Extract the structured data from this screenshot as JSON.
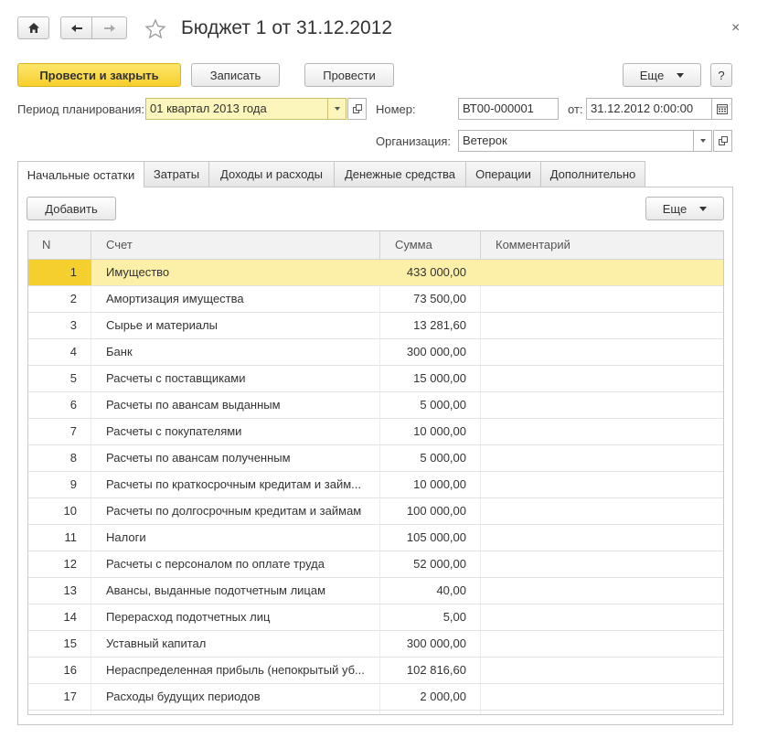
{
  "window": {
    "title": "Бюджет 1 от 31.12.2012",
    "close_glyph": "×"
  },
  "toolbar": {
    "post_close_label": "Провести и закрыть",
    "save_label": "Записать",
    "post_label": "Провести",
    "more_label": "Еще",
    "help_label": "?"
  },
  "header": {
    "period_label": "Период планирования:",
    "period_value": "01 квартал 2013 года",
    "number_label": "Номер:",
    "number_value": "ВТ00-000001",
    "date_label": "от:",
    "date_value": "31.12.2012  0:00:00",
    "org_label": "Организация:",
    "org_value": "Ветерок"
  },
  "tabs": [
    {
      "label": "Начальные остатки",
      "active": true
    },
    {
      "label": "Затраты"
    },
    {
      "label": "Доходы и расходы"
    },
    {
      "label": "Денежные средства"
    },
    {
      "label": "Операции"
    },
    {
      "label": "Дополнительно"
    }
  ],
  "tab_toolbar": {
    "add_label": "Добавить",
    "more_label": "Еще"
  },
  "table": {
    "columns": [
      "N",
      "Счет",
      "Сумма",
      "Комментарий"
    ],
    "rows": [
      {
        "n": "1",
        "account": "Имущество",
        "sum": "433 000,00",
        "comment": ""
      },
      {
        "n": "2",
        "account": "Амортизация имущества",
        "sum": "73 500,00",
        "comment": ""
      },
      {
        "n": "3",
        "account": "Сырье и материалы",
        "sum": "13 281,60",
        "comment": ""
      },
      {
        "n": "4",
        "account": "Банк",
        "sum": "300 000,00",
        "comment": ""
      },
      {
        "n": "5",
        "account": "Расчеты с поставщиками",
        "sum": "15 000,00",
        "comment": ""
      },
      {
        "n": "6",
        "account": "Расчеты по авансам выданным",
        "sum": "5 000,00",
        "comment": ""
      },
      {
        "n": "7",
        "account": "Расчеты с покупателями",
        "sum": "10 000,00",
        "comment": ""
      },
      {
        "n": "8",
        "account": "Расчеты по авансам полученным",
        "sum": "5 000,00",
        "comment": ""
      },
      {
        "n": "9",
        "account": "Расчеты по краткосрочным кредитам и займ...",
        "sum": "10 000,00",
        "comment": ""
      },
      {
        "n": "10",
        "account": "Расчеты по долгосрочным кредитам и займам",
        "sum": "100 000,00",
        "comment": ""
      },
      {
        "n": "11",
        "account": "Налоги",
        "sum": "105 000,00",
        "comment": ""
      },
      {
        "n": "12",
        "account": "Расчеты с персоналом по оплате труда",
        "sum": "52 000,00",
        "comment": ""
      },
      {
        "n": "13",
        "account": "Авансы, выданные подотчетным лицам",
        "sum": "40,00",
        "comment": ""
      },
      {
        "n": "14",
        "account": "Перерасход подотчетных лиц",
        "sum": "5,00",
        "comment": ""
      },
      {
        "n": "15",
        "account": "Уставный капитал",
        "sum": "300 000,00",
        "comment": ""
      },
      {
        "n": "16",
        "account": "Нераспределенная прибыль (непокрытый уб...",
        "sum": "102 816,60",
        "comment": ""
      },
      {
        "n": "17",
        "account": "Расходы будущих периодов",
        "sum": "2 000,00",
        "comment": ""
      }
    ]
  },
  "colors": {
    "accent_yellow": "#f7cf2c",
    "selected_row": "#fcf0a8",
    "input_highlight": "#fcf6bd"
  }
}
